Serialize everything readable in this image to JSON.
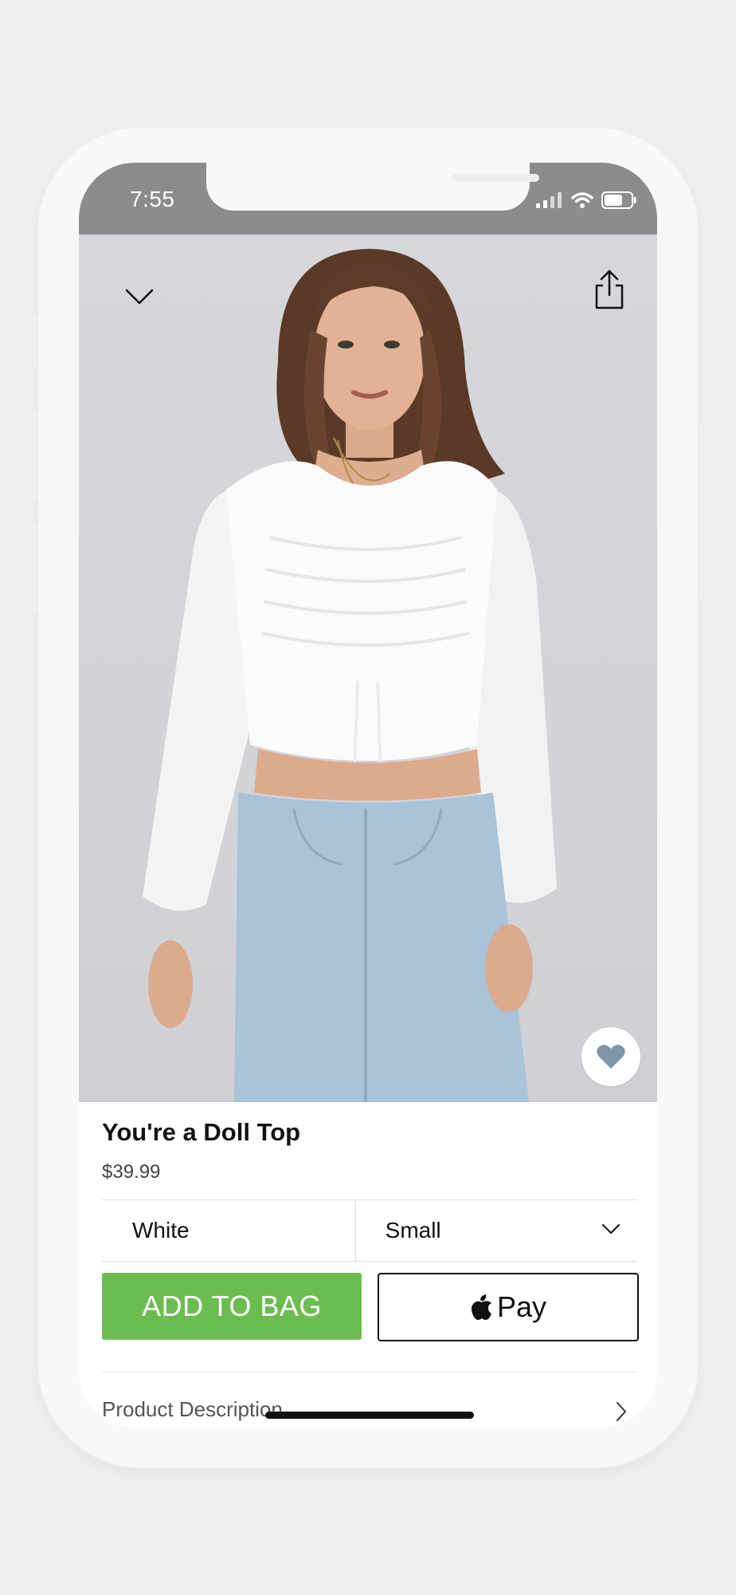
{
  "status_bar": {
    "time": "7:55",
    "icons": [
      "cellular-signal-icon",
      "wifi-icon",
      "battery-icon"
    ]
  },
  "header": {
    "collapse_icon": "chevron-down-icon",
    "share_icon": "share-icon"
  },
  "product": {
    "title": "You're a Doll Top",
    "price": "$39.99",
    "favorite_icon": "heart-icon",
    "image_subject": "Model wearing white ruched long-sleeve crop top with light-wash jeans"
  },
  "options": {
    "color_value": "White",
    "size_value": "Small",
    "size_icon": "chevron-down-icon"
  },
  "actions": {
    "add_to_bag_label": "ADD TO BAG",
    "apple_pay_label": "Pay",
    "apple_pay_icon": "apple-logo-icon"
  },
  "sections": {
    "description_label": "Product Description",
    "description_icon": "chevron-right-icon"
  },
  "colors": {
    "status_bar_bg": "#8c8c8c",
    "add_button_green": "#6cbd50",
    "favorite_heart": "#7f97ab"
  }
}
